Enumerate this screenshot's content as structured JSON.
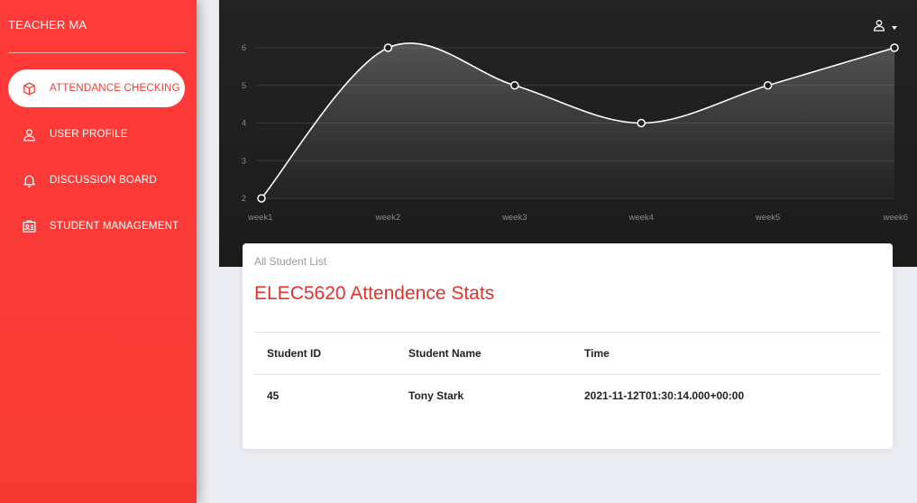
{
  "sidebar": {
    "brand": "TEACHER MA",
    "items": [
      {
        "label": "ATTENDANCE CHECKING",
        "icon": "cube-icon",
        "active": true
      },
      {
        "label": "USER PROFILE",
        "icon": "user-icon",
        "active": false
      },
      {
        "label": "DISCUSSION BOARD",
        "icon": "bell-icon",
        "active": false
      },
      {
        "label": "STUDENT MANAGEMENT",
        "icon": "id-card-icon",
        "active": false
      }
    ]
  },
  "header": {
    "user_icon": "user-icon"
  },
  "chart_data": {
    "type": "line",
    "categories": [
      "week1",
      "week2",
      "week3",
      "week4",
      "week5",
      "week6"
    ],
    "series": [
      {
        "values": [
          2,
          6,
          5,
          4,
          5,
          6
        ]
      }
    ],
    "y_ticks": [
      2,
      3,
      4,
      5,
      6
    ],
    "ylim": [
      2,
      6
    ],
    "grid": true,
    "colors": {
      "line": "#ffffff",
      "tick": "#8a8a8a",
      "grid": "#3a3a3a"
    }
  },
  "card": {
    "category": "All Student List",
    "title": "ELEC5620 Attendence Stats",
    "columns": [
      "Student ID",
      "Student Name",
      "Time"
    ],
    "rows": [
      [
        "45",
        "Tony Stark",
        "2021-11-12T01:30:14.000+00:00"
      ]
    ]
  },
  "colors": {
    "accent": "#f53a33",
    "sidebar_bg": "#ff3a3a",
    "dark_panel": "#1f1f1f"
  }
}
